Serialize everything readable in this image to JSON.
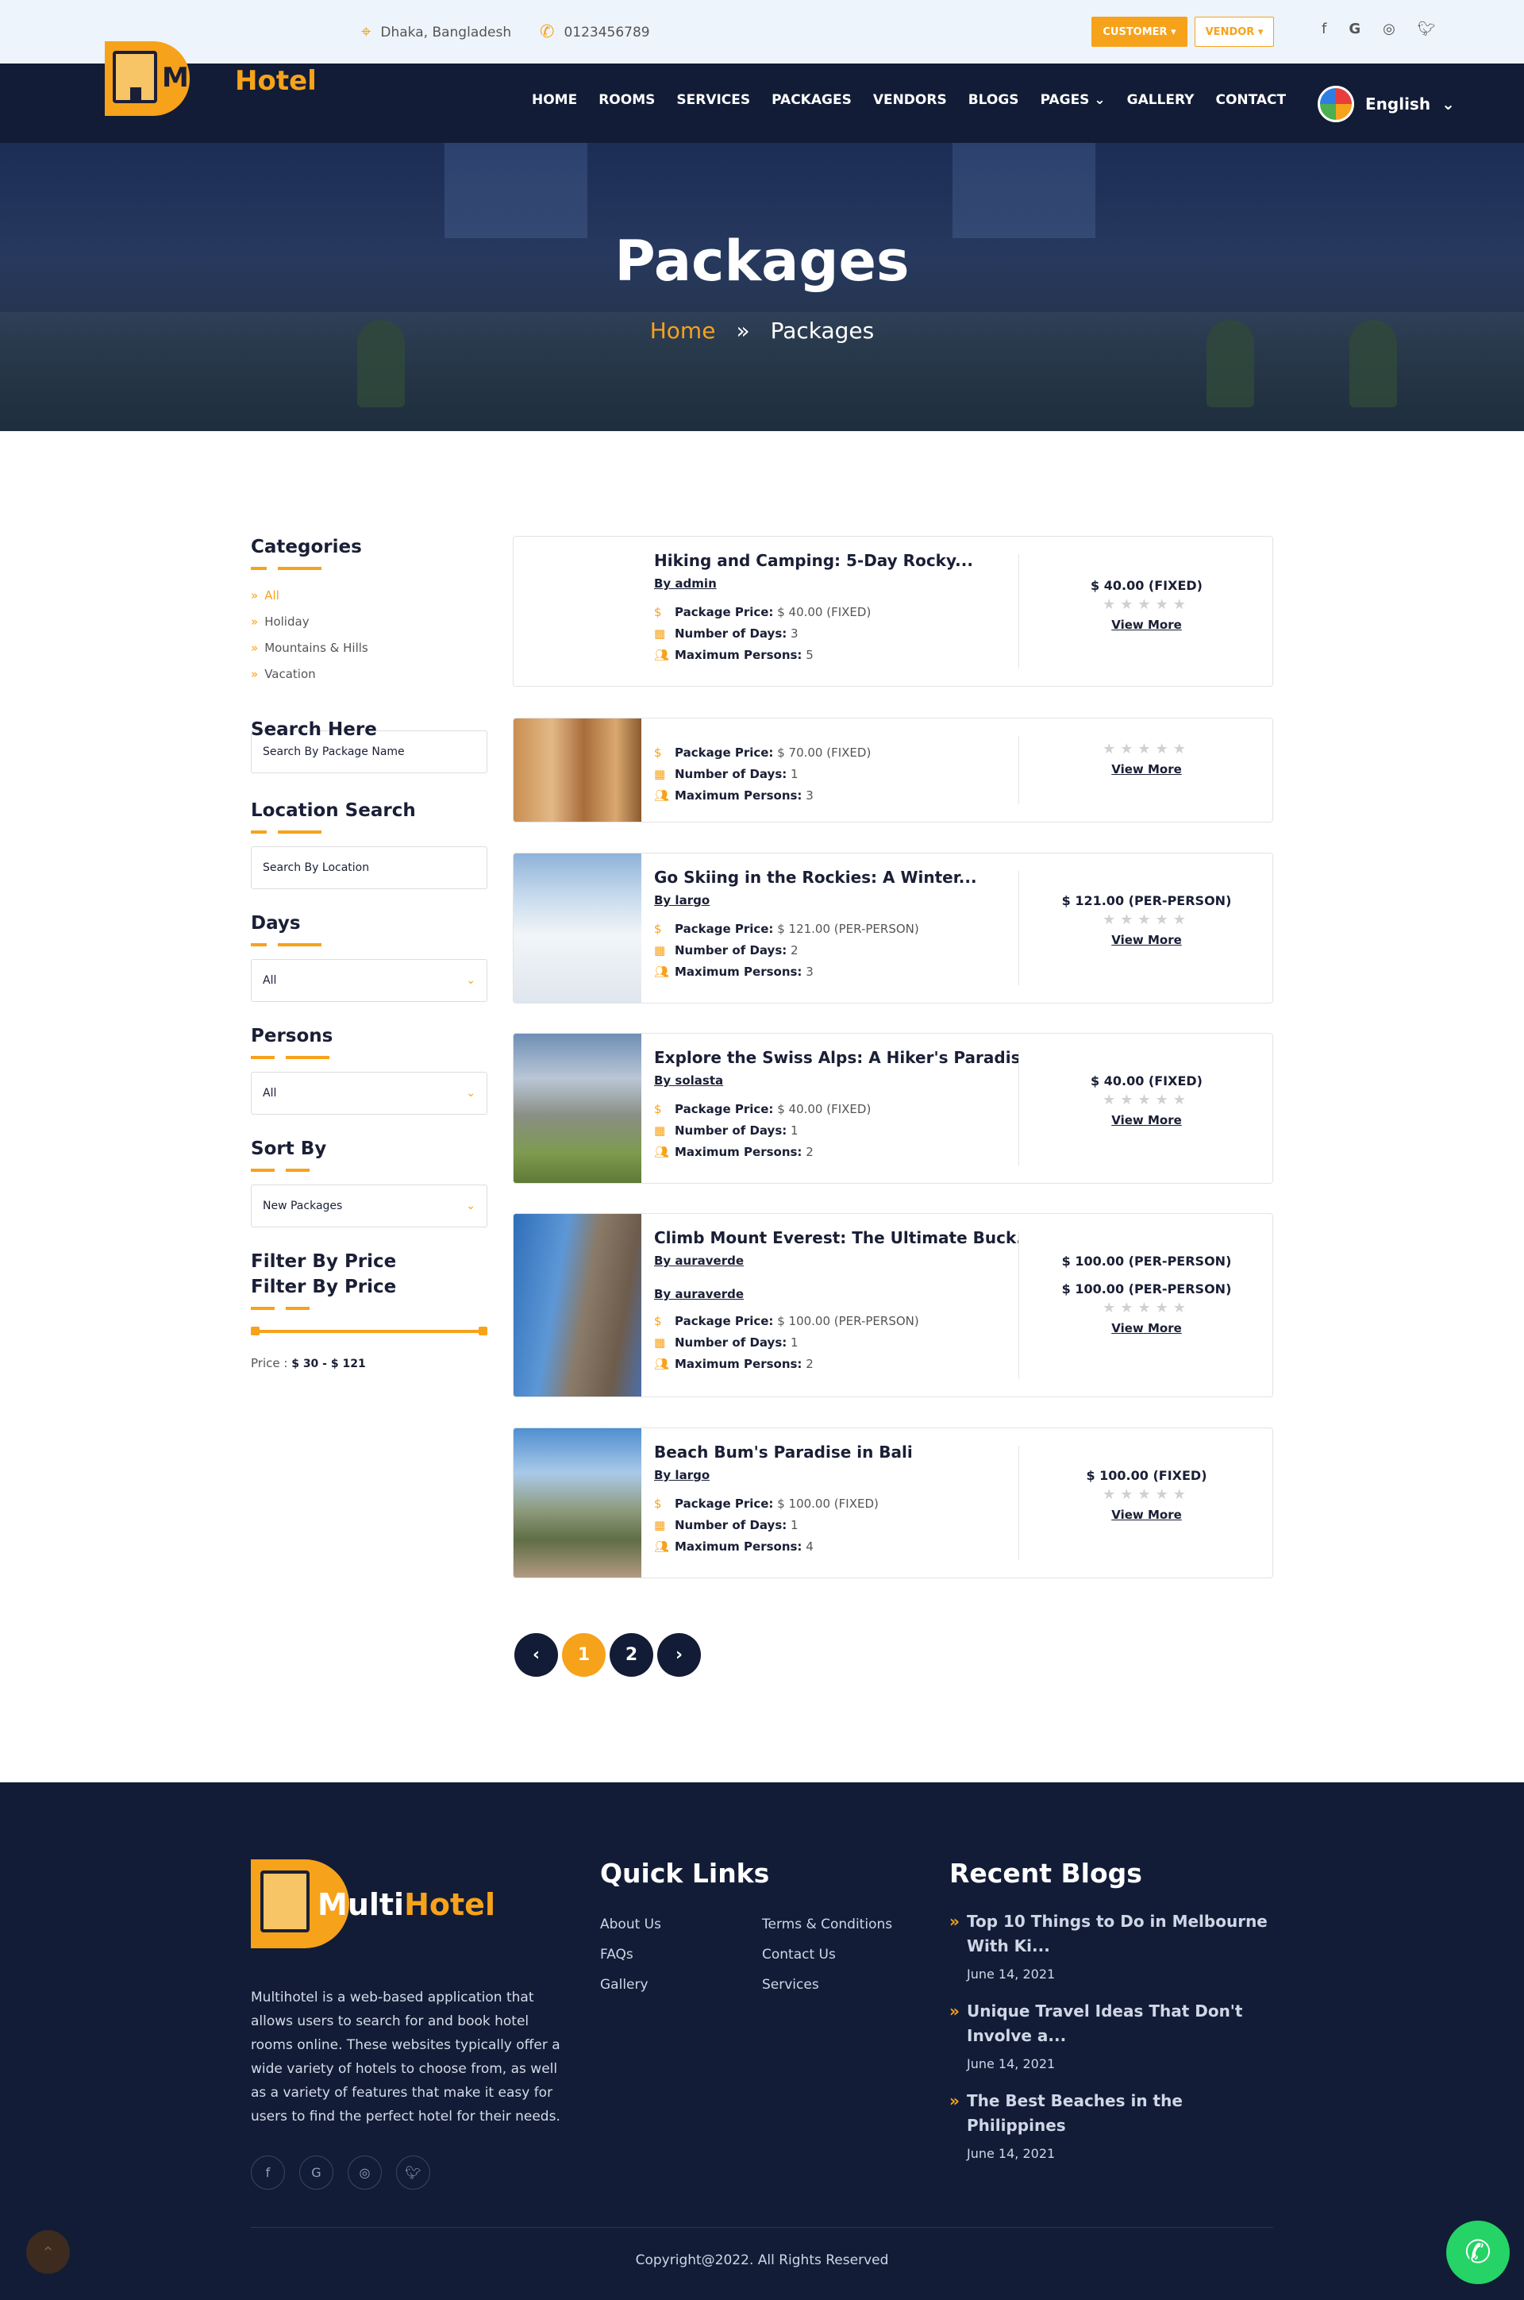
{
  "topbar": {
    "location": "Dhaka, Bangladesh",
    "phone": "0123456789",
    "customer_label": "CUSTOMER",
    "vendor_label": "VENDOR",
    "social": [
      "facebook-icon",
      "google-icon",
      "instagram-icon",
      "twitter-icon"
    ]
  },
  "brand": {
    "logo_letter": "M",
    "name": "Hotel"
  },
  "nav": {
    "items": [
      "HOME",
      "ROOMS",
      "SERVICES",
      "PACKAGES",
      "VENDORS",
      "BLOGS",
      "PAGES",
      "GALLERY",
      "CONTACT"
    ],
    "language": "English"
  },
  "hero": {
    "title": "Packages",
    "crumb_home": "Home",
    "crumb_current": "Packages"
  },
  "sidebar": {
    "categories_title": "Categories",
    "categories": [
      "All",
      "Holiday",
      "Mountains & Hills",
      "Vacation"
    ],
    "search_title": "Search Here",
    "search_placeholder": "Search By Package Name",
    "location_title": "Location Search",
    "location_placeholder": "Search By Location",
    "days_title": "Days",
    "days_value": "All",
    "persons_title": "Persons",
    "persons_value": "All",
    "sort_title": "Sort By",
    "sort_value": "New Packages",
    "price_title_1": "Filter By Price",
    "price_title_2": "Filter By Price",
    "price_label": "Price :",
    "price_range": "$ 30 - $ 121"
  },
  "labels": {
    "package_price": "Package Price:",
    "days": "Number of Days:",
    "persons": "Maximum Persons:",
    "view_more": "View More"
  },
  "packages": [
    {
      "title": "Hiking and Camping: 5-Day Rocky...",
      "by": "By admin",
      "price_detail": "$ 40.00 (FIXED)",
      "days": "3",
      "persons": "5",
      "price": "$ 40.00 (FIXED)"
    },
    {
      "title": "",
      "by": "",
      "price_detail": "$ 70.00 (FIXED)",
      "days": "1",
      "persons": "3",
      "price": ""
    },
    {
      "title": "Go Skiing in the Rockies: A Winter...",
      "by": "By largo",
      "price_detail": "$ 121.00 (PER-PERSON)",
      "days": "2",
      "persons": "3",
      "price": "$ 121.00 (PER-PERSON)"
    },
    {
      "title": "Explore the Swiss Alps: A Hiker's Paradise",
      "by": "By solasta",
      "price_detail": "$ 40.00 (FIXED)",
      "days": "1",
      "persons": "2",
      "price": "$ 40.00 (FIXED)"
    },
    {
      "title": "Climb Mount Everest: The Ultimate Buck...",
      "by": "By auraverde",
      "by2": "By auraverde",
      "price_detail": "$ 100.00 (PER-PERSON)",
      "days": "1",
      "persons": "2",
      "price": "$ 100.00 (PER-PERSON)",
      "price2": "$ 100.00 (PER-PERSON)"
    },
    {
      "title": "Beach Bum's Paradise in Bali",
      "by": "By largo",
      "price_detail": "$ 100.00 (FIXED)",
      "days": "1",
      "persons": "4",
      "price": "$ 100.00 (FIXED)"
    }
  ],
  "pager": {
    "prev": "‹",
    "pages": [
      "1",
      "2"
    ],
    "next": "›"
  },
  "footer": {
    "logo_a": "Multi",
    "logo_b": "Hotel",
    "description": "Multihotel is a web-based application that allows users to search for and book hotel rooms online. These websites typically offer a wide variety of hotels to choose from, as well as a variety of features that make it easy for users to find the perfect hotel for their needs.",
    "quick_links_title": "Quick Links",
    "links_col1": [
      "About Us",
      "FAQs",
      "Gallery"
    ],
    "links_col2": [
      "Terms & Conditions",
      "Contact Us",
      "Services"
    ],
    "recent_title": "Recent Blogs",
    "blogs": [
      {
        "title": "Top 10 Things to Do in Melbourne With Ki...",
        "date": "June 14, 2021"
      },
      {
        "title": "Unique Travel Ideas That Don't Involve a...",
        "date": "June 14, 2021"
      },
      {
        "title": "The Best Beaches in the Philippines",
        "date": "June 14, 2021"
      }
    ],
    "copyright": "Copyright@2022. All Rights Reserved"
  },
  "colors": {
    "accent": "#f7a21b",
    "navy": "#121c36"
  }
}
